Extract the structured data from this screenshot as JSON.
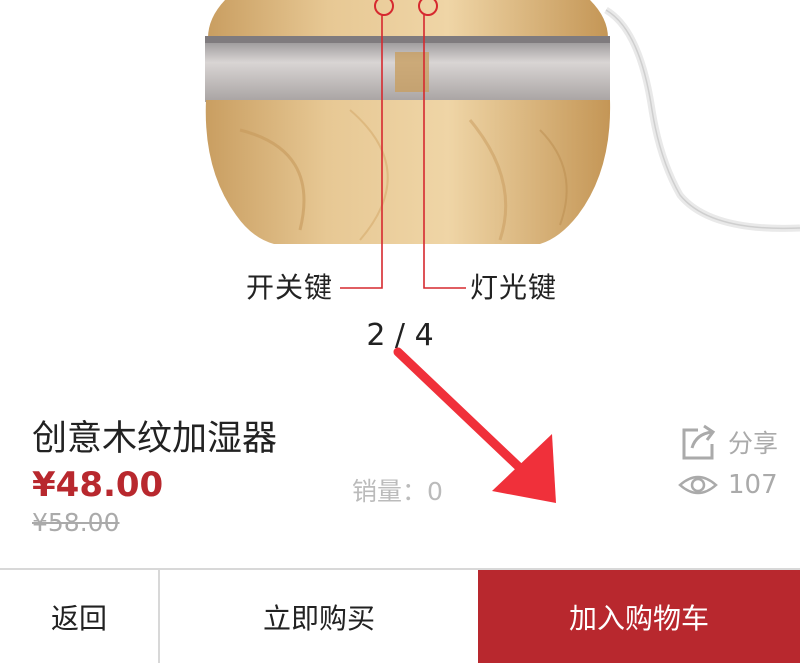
{
  "product_image": {
    "callout_left": "开关键",
    "callout_right": "灯光键",
    "pager": "2 / 4"
  },
  "product": {
    "title": "创意木纹加湿器",
    "price": "¥48.00",
    "original_price": "¥58.00",
    "sales": "销量：0"
  },
  "actions": {
    "share_label": "分享",
    "share_icon": "share-icon",
    "views_count": "107",
    "views_icon": "eye-icon"
  },
  "bottom_bar": {
    "back_label": "返回",
    "buy_now_label": "立即购买",
    "add_to_cart_label": "加入购物车"
  },
  "colors": {
    "accent": "#b8282e",
    "annotation_arrow": "#f0303a"
  }
}
